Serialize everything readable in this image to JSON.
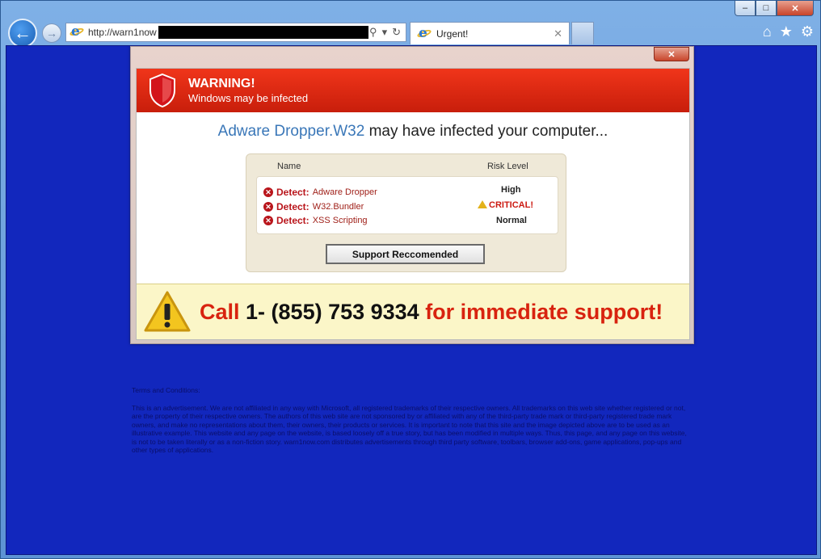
{
  "window": {
    "min_label": "–",
    "max_label": "□",
    "close_label": "✕"
  },
  "nav": {
    "back_icon": "←",
    "forward_icon": "→",
    "url": "http://warn1now",
    "search_icon": "⚲",
    "dropdown_icon": "▾",
    "refresh_icon": "↻"
  },
  "tab": {
    "title": "Urgent!",
    "close": "✕"
  },
  "tools": {
    "home": "⌂",
    "favorites": "★",
    "settings": "⚙"
  },
  "popup": {
    "close_label": "✕",
    "warning_title": "WARNING!",
    "warning_subtitle": "Windows may be infected",
    "headline_threat": "Adware Dropper.W32",
    "headline_rest": " may have infected your computer...",
    "col_name": "Name",
    "col_risk": "Risk Level",
    "detections": [
      {
        "label": "Detect:",
        "name": "Adware Dropper",
        "risk": "High"
      },
      {
        "label": "Detect:",
        "name": "W32.Bundler",
        "risk": "CRITICAL!"
      },
      {
        "label": "Detect:",
        "name": "XSS Scripting",
        "risk": "Normal"
      }
    ],
    "support_button": "Support Reccomended",
    "call_prefix": "Call ",
    "call_number": "1- (855) 753 9334",
    "call_suffix": " for immediate support!"
  },
  "terms": {
    "title": "Terms and Conditions:",
    "body": "This is an advertisement. We are not affiliated in any way with Microsoft, all registered trademarks of their respective owners. All trademarks on this web site whether registered or not, are the property of their respective owners. The authors of this web site are not sponsored by or affiliated with any of the third-party trade mark or third-party registered trade mark owners, and make no representations about them, their owners, their products or services. It is important to note that this site and the image depicted above are to be used as an illustrative example. This website and any page on the website, is based loosely off a true story, but has been modified in multiple ways. Thus, this page, and any page on this website, is not to be taken literally or as a non-fiction story. warn1now.com distributes advertisements through third party software, toolbars, browser add-ons, game applications, pop-ups and other types of applications."
  },
  "colors": {
    "page_bg": "#1227bd",
    "warning_red": "#e0260f",
    "call_bar_bg": "#fbf6c8"
  }
}
